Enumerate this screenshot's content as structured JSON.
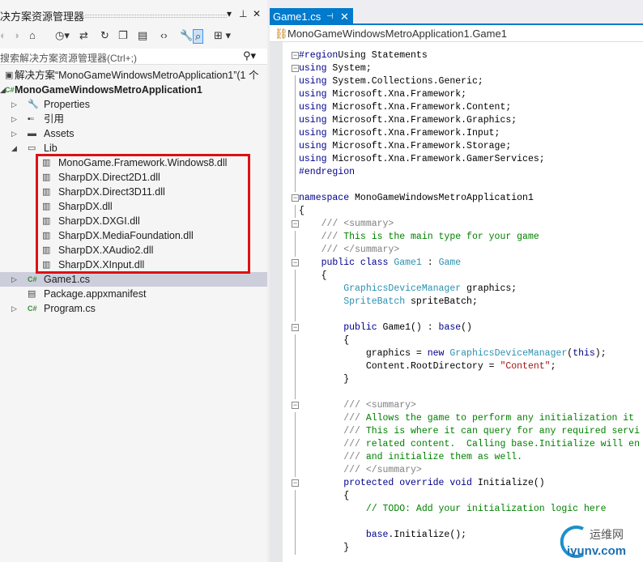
{
  "panel": {
    "title": "决方案资源管理器",
    "pin": "▾ ⊥ ✕",
    "search_placeholder": "搜索解决方案资源管理器(Ctrl+;)"
  },
  "tree": [
    {
      "label": "解决方案“MonoGameWindowsMetroApplication1”(1 个",
      "icon": "solution-icon",
      "level": 0,
      "arrow": ""
    },
    {
      "label": "MonoGameWindowsMetroApplication1",
      "icon": "csharp-project-icon",
      "level": 0,
      "arrow": "◢",
      "bold": true
    },
    {
      "label": "Properties",
      "icon": "wrench-icon",
      "level": 1,
      "arrow": "▷"
    },
    {
      "label": "引用",
      "icon": "references-icon",
      "level": 1,
      "arrow": "▷"
    },
    {
      "label": "Assets",
      "icon": "folder-icon",
      "level": 1,
      "arrow": "▷"
    },
    {
      "label": "Lib",
      "icon": "folder-open-icon",
      "level": 1,
      "arrow": "◢"
    },
    {
      "label": "MonoGame.Framework.Windows8.dll",
      "icon": "assembly-icon",
      "level": 2
    },
    {
      "label": "SharpDX.Direct2D1.dll",
      "icon": "assembly-icon",
      "level": 2
    },
    {
      "label": "SharpDX.Direct3D11.dll",
      "icon": "assembly-icon",
      "level": 2
    },
    {
      "label": "SharpDX.dll",
      "icon": "assembly-icon",
      "level": 2
    },
    {
      "label": "SharpDX.DXGI.dll",
      "icon": "assembly-icon",
      "level": 2
    },
    {
      "label": "SharpDX.MediaFoundation.dll",
      "icon": "assembly-icon",
      "level": 2
    },
    {
      "label": "SharpDX.XAudio2.dll",
      "icon": "assembly-icon",
      "level": 2
    },
    {
      "label": "SharpDX.XInput.dll",
      "icon": "assembly-icon",
      "level": 2
    },
    {
      "label": "Game1.cs",
      "icon": "csharp-file-icon",
      "level": 1,
      "arrow": "▷",
      "selected": true
    },
    {
      "label": "Package.appxmanifest",
      "icon": "manifest-icon",
      "level": 1,
      "arrow": ""
    },
    {
      "label": "Program.cs",
      "icon": "csharp-file-icon",
      "level": 1,
      "arrow": "▷"
    }
  ],
  "editor": {
    "tab": "Game1.cs",
    "tab_pin": "⊣",
    "tab_close": "✕",
    "breadcrumb": "MonoGameWindowsMetroApplication1.Game1"
  },
  "code": [
    [
      [
        "kw",
        "#region"
      ],
      [
        "",
        "Using Statements"
      ]
    ],
    [
      [
        "kw",
        "using"
      ],
      [
        "",
        " System;"
      ]
    ],
    [
      [
        "kw",
        "using"
      ],
      [
        "",
        " System.Collections.Generic;"
      ]
    ],
    [
      [
        "kw",
        "using"
      ],
      [
        "",
        " Microsoft.Xna.Framework;"
      ]
    ],
    [
      [
        "kw",
        "using"
      ],
      [
        "",
        " Microsoft.Xna.Framework.Content;"
      ]
    ],
    [
      [
        "kw",
        "using"
      ],
      [
        "",
        " Microsoft.Xna.Framework.Graphics;"
      ]
    ],
    [
      [
        "kw",
        "using"
      ],
      [
        "",
        " Microsoft.Xna.Framework.Input;"
      ]
    ],
    [
      [
        "kw",
        "using"
      ],
      [
        "",
        " Microsoft.Xna.Framework.Storage;"
      ]
    ],
    [
      [
        "kw",
        "using"
      ],
      [
        "",
        " Microsoft.Xna.Framework.GamerServices;"
      ]
    ],
    [
      [
        "kw",
        "#endregion"
      ]
    ],
    [],
    [
      [
        "kw",
        "namespace"
      ],
      [
        "",
        " MonoGameWindowsMetroApplication1"
      ]
    ],
    [
      [
        "",
        "{"
      ]
    ],
    [
      [
        "xd",
        "    /// <summary>"
      ]
    ],
    [
      [
        "xd",
        "    ///"
      ],
      [
        "cm",
        " This is the main type for your game"
      ]
    ],
    [
      [
        "xd",
        "    /// </summary>"
      ]
    ],
    [
      [
        "kw",
        "    public class"
      ],
      [
        "ty",
        " Game1"
      ],
      [
        "",
        " : "
      ],
      [
        "ty",
        "Game"
      ]
    ],
    [
      [
        "",
        "    {"
      ]
    ],
    [
      [
        "ty",
        "        GraphicsDeviceManager"
      ],
      [
        "",
        " graphics;"
      ]
    ],
    [
      [
        "ty",
        "        SpriteBatch"
      ],
      [
        "",
        " spriteBatch;"
      ]
    ],
    [],
    [
      [
        "kw",
        "        public"
      ],
      [
        "",
        " Game1() : "
      ],
      [
        "kw",
        "base"
      ],
      [
        "",
        "()"
      ]
    ],
    [
      [
        "",
        "        {"
      ]
    ],
    [
      [
        "",
        "            graphics = "
      ],
      [
        "kw",
        "new"
      ],
      [
        "ty",
        " GraphicsDeviceManager"
      ],
      [
        "",
        "("
      ],
      [
        "kw",
        "this"
      ],
      [
        "",
        ");"
      ]
    ],
    [
      [
        "",
        "            Content.RootDirectory = "
      ],
      [
        "st",
        "\"Content\""
      ],
      [
        "",
        ";"
      ]
    ],
    [
      [
        "",
        "        }"
      ]
    ],
    [],
    [
      [
        "xd",
        "        /// <summary>"
      ]
    ],
    [
      [
        "xd",
        "        ///"
      ],
      [
        "cm",
        " Allows the game to perform any initialization it"
      ]
    ],
    [
      [
        "xd",
        "        ///"
      ],
      [
        "cm",
        " This is where it can query for any required servi"
      ]
    ],
    [
      [
        "xd",
        "        ///"
      ],
      [
        "cm",
        " related content.  Calling base.Initialize will en"
      ]
    ],
    [
      [
        "xd",
        "        ///"
      ],
      [
        "cm",
        " and initialize them as well."
      ]
    ],
    [
      [
        "xd",
        "        /// </summary>"
      ]
    ],
    [
      [
        "kw",
        "        protected override void"
      ],
      [
        "",
        " Initialize()"
      ]
    ],
    [
      [
        "",
        "        {"
      ]
    ],
    [
      [
        "cm",
        "            // TODO: Add your initialization logic here"
      ]
    ],
    [],
    [
      [
        "kw",
        "            base"
      ],
      [
        "",
        ".Initialize();"
      ]
    ],
    [
      [
        "",
        "        }"
      ]
    ]
  ],
  "collapsible_lines": [
    0,
    1,
    11,
    13,
    16,
    21,
    27,
    33
  ],
  "watermark": {
    "cn": "运维网",
    "en": "iyunv.com"
  }
}
